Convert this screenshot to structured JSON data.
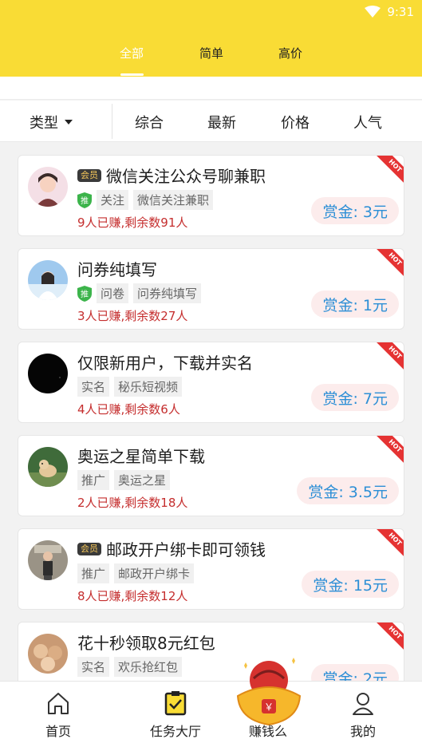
{
  "status": {
    "time": "9:31",
    "wifi_icon": "wifi-icon"
  },
  "tabs": [
    {
      "label": "全部",
      "active": true
    },
    {
      "label": "简单",
      "active": false
    },
    {
      "label": "高价",
      "active": false
    }
  ],
  "filter": {
    "type_label": "类型",
    "sorts": [
      "综合",
      "最新",
      "价格",
      "人气"
    ]
  },
  "tasks": [
    {
      "vip": "会员",
      "title": "微信关注公众号聊兼职",
      "recommended": true,
      "recommend_label": "推",
      "tags": [
        "关注",
        "微信关注兼职"
      ],
      "stats": "9人已赚,剩余数91人",
      "reward": "赏金: 3元",
      "hot": "HOT"
    },
    {
      "vip": "",
      "title": "问券纯填写",
      "recommended": true,
      "recommend_label": "推",
      "tags": [
        "问卷",
        "问券纯填写"
      ],
      "stats": "3人已赚,剩余数27人",
      "reward": "赏金: 1元",
      "hot": "HOT"
    },
    {
      "vip": "",
      "title": "仅限新用户，下载并实名",
      "recommended": false,
      "recommend_label": "",
      "tags": [
        "实名",
        "秘乐短视频"
      ],
      "stats": "4人已赚,剩余数6人",
      "reward": "赏金: 7元",
      "hot": "HOT"
    },
    {
      "vip": "",
      "title": "奥运之星简单下载",
      "recommended": false,
      "recommend_label": "",
      "tags": [
        "推广",
        "奥运之星"
      ],
      "stats": "2人已赚,剩余数18人",
      "reward": "赏金: 3.5元",
      "hot": "HOT"
    },
    {
      "vip": "会员",
      "title": "邮政开户绑卡即可领钱",
      "recommended": false,
      "recommend_label": "",
      "tags": [
        "推广",
        "邮政开户绑卡"
      ],
      "stats": "8人已赚,剩余数12人",
      "reward": "赏金: 15元",
      "hot": "HOT"
    },
    {
      "vip": "",
      "title": "花十秒领取8元红包",
      "recommended": false,
      "recommend_label": "",
      "tags": [
        "实名",
        "欢乐抢红包"
      ],
      "stats": "",
      "reward": "赏金: 2元",
      "hot": "HOT"
    }
  ],
  "nav": [
    {
      "label": "首页",
      "icon": "home-icon"
    },
    {
      "label": "任务大厅",
      "icon": "task-clipboard-icon"
    },
    {
      "label": "赚钱么",
      "icon": "gold-ingot-icon"
    },
    {
      "label": "我的",
      "icon": "profile-icon"
    }
  ],
  "colors": {
    "brand_yellow": "#f9dc35",
    "reward_blue": "#2d8fd6",
    "stats_red": "#c52e2e",
    "hot_red": "#e53333"
  }
}
